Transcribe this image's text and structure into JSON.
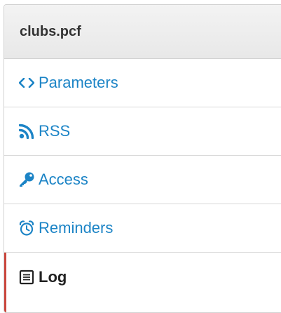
{
  "panel": {
    "title": "clubs.pcf",
    "accent_color": "#1c84c6",
    "active_color": "#c9463d",
    "items": [
      {
        "label": "Parameters",
        "icon": "code-icon"
      },
      {
        "label": "RSS",
        "icon": "rss-icon"
      },
      {
        "label": "Access",
        "icon": "key-icon"
      },
      {
        "label": "Reminders",
        "icon": "alarm-clock-icon"
      },
      {
        "label": "Log",
        "icon": "log-list-icon",
        "active": true
      }
    ]
  }
}
